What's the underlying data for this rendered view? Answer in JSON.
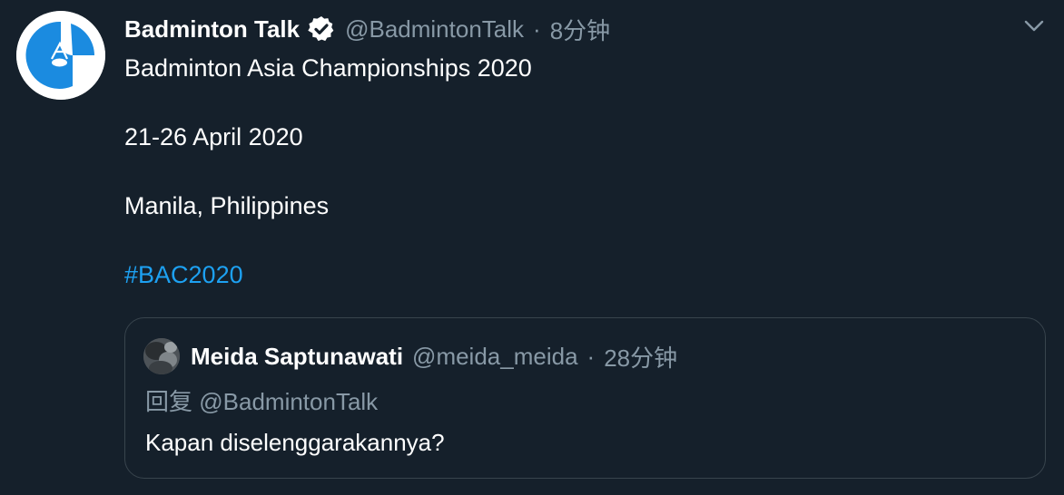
{
  "tweet": {
    "author": {
      "name": "Badminton Talk",
      "handle": "@BadmintonTalk",
      "verified": true,
      "avatar_icon": "shuttlecock-logo-icon"
    },
    "separator": "·",
    "time": "8分钟",
    "menu_icon": "chevron-down-icon",
    "text_lines": [
      "Badminton Asia Championships 2020",
      "21-26 April 2020",
      "Manila, Philippines"
    ],
    "hashtag": "#BAC2020"
  },
  "quoted_tweet": {
    "author": {
      "name": "Meida Saptunawati",
      "handle": "@meida_meida",
      "avatar_icon": "user-avatar-photo"
    },
    "separator": "·",
    "time": "28分钟",
    "reply_prefix": "回复",
    "reply_to": "@BadmintonTalk",
    "text": "Kapan diselenggarakannya?"
  },
  "colors": {
    "background": "#15202b",
    "text": "#ffffff",
    "secondary_text": "#8899a6",
    "accent": "#1da1f2",
    "border": "#38444d"
  }
}
